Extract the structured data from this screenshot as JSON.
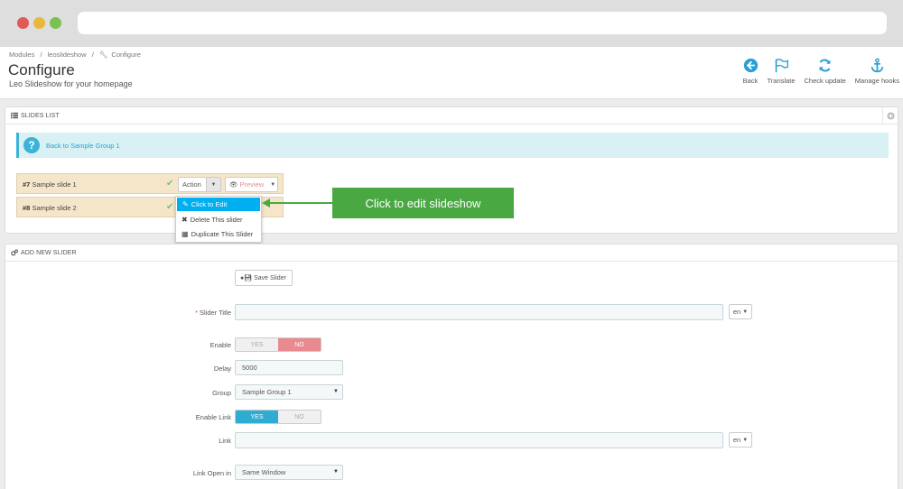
{
  "breadcrumb": [
    "Modules",
    "/",
    "leoslideshow",
    "/",
    "Configure"
  ],
  "page": {
    "title": "Configure",
    "subtitle": "Leo Slideshow for your homepage"
  },
  "toolbar": [
    {
      "label": "Back",
      "icon": "back-arrow-icon"
    },
    {
      "label": "Translate",
      "icon": "flag-icon"
    },
    {
      "label": "Check update",
      "icon": "refresh-icon"
    },
    {
      "label": "Manage hooks",
      "icon": "anchor-icon"
    }
  ],
  "slides_panel": {
    "title": "SLIDES LIST",
    "info_link": "Back to Sample Group 1",
    "slides": [
      {
        "id": "#7",
        "name": "Sample slide 1"
      },
      {
        "id": "#8",
        "name": "Sample slide 2"
      }
    ],
    "action_label": "Action",
    "preview_label": "Preview",
    "dropdown": [
      "Click to Edit",
      "Delete This slider",
      "Duplicate This Slider"
    ],
    "callout": "Click to edit slideshow"
  },
  "add_panel": {
    "title": "ADD NEW SLIDER",
    "save_label": "Save Slider",
    "fields": {
      "slider_title_label": "Slider Title",
      "lang": "en",
      "enable_label": "Enable",
      "yes": "YES",
      "no": "NO",
      "delay_label": "Delay",
      "delay_value": "5000",
      "group_label": "Group",
      "group_value": "Sample Group 1",
      "enable_link_label": "Enable Link",
      "link_label": "Link",
      "link_open_label": "Link Open in",
      "link_open_value": "Same Window"
    }
  },
  "colors": {
    "accent": "#00aff0",
    "callout": "#4aa843",
    "slide_row": "#f5e6c9",
    "no_active": "#e88a8f",
    "yes_active": "#2eacd1"
  }
}
